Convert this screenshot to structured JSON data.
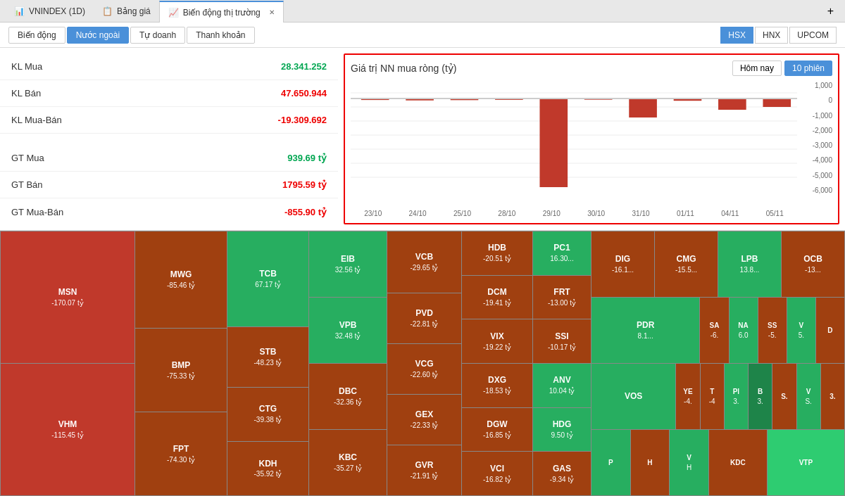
{
  "tabs": [
    {
      "id": "vnindex",
      "label": "VNINDEX (1D)",
      "icon": "📊",
      "active": false
    },
    {
      "id": "banggia",
      "label": "Bảng giá",
      "icon": "📋",
      "active": false
    },
    {
      "id": "biendong",
      "label": "Biến động thị trường",
      "icon": "📈",
      "active": true
    }
  ],
  "sub_nav": {
    "left_buttons": [
      {
        "id": "biendong",
        "label": "Biến động"
      },
      {
        "id": "nuocngoai",
        "label": "Nước ngoài",
        "active": true
      },
      {
        "id": "tudoanh",
        "label": "Tự doanh"
      },
      {
        "id": "thanhkhoan",
        "label": "Thanh khoản"
      }
    ],
    "right_buttons": [
      {
        "id": "hsx",
        "label": "HSX",
        "active": true
      },
      {
        "id": "hnx",
        "label": "HNX"
      },
      {
        "id": "upcom",
        "label": "UPCOM"
      }
    ]
  },
  "stats": [
    {
      "label": "KL Mua",
      "value": "28.341.252",
      "color": "green"
    },
    {
      "label": "KL Bán",
      "value": "47.650.944",
      "color": "red"
    },
    {
      "label": "KL Mua-Bán",
      "value": "-19.309.692",
      "color": "red"
    },
    {
      "spacer": true
    },
    {
      "label": "GT Mua",
      "value": "939.69 tỷ",
      "color": "green"
    },
    {
      "label": "GT Bán",
      "value": "1795.59 tỷ",
      "color": "red"
    },
    {
      "label": "GT Mua-Bán",
      "value": "-855.90 tỷ",
      "color": "red"
    }
  ],
  "chart": {
    "title": "Giá trị NN mua ròng (tỷ)",
    "period_buttons": [
      {
        "label": "Hôm nay"
      },
      {
        "label": "10 phiên",
        "active": true
      }
    ],
    "x_labels": [
      "23/10",
      "24/10",
      "25/10",
      "28/10",
      "29/10",
      "30/10",
      "31/10",
      "01/11",
      "04/11",
      "05/11"
    ],
    "y_labels": [
      "1,000",
      "0",
      "-1,000",
      "-2,000",
      "-3,000",
      "-4,000",
      "-5,000",
      "-6,000"
    ],
    "bars": [
      {
        "x": 0,
        "value": -50
      },
      {
        "x": 1,
        "value": -80
      },
      {
        "x": 2,
        "value": -60
      },
      {
        "x": 3,
        "value": -40
      },
      {
        "x": 4,
        "value": -5800
      },
      {
        "x": 5,
        "value": -30
      },
      {
        "x": 6,
        "value": -1200
      },
      {
        "x": 7,
        "value": -100
      },
      {
        "x": 8,
        "value": -700
      },
      {
        "x": 9,
        "value": -500
      }
    ]
  },
  "treemap": {
    "cells": [
      {
        "sym": "MSN",
        "val": "-170.07 tỷ",
        "bg": "dark-red",
        "size": "xl"
      },
      {
        "sym": "VHM",
        "val": "-115.45 tỷ",
        "bg": "dark-red",
        "size": "xl"
      },
      {
        "sym": "MWG",
        "val": "-85.46 tỷ",
        "bg": "orange",
        "size": "l"
      },
      {
        "sym": "BMP",
        "val": "-75.33 tỷ",
        "bg": "orange",
        "size": "l"
      },
      {
        "sym": "FPT",
        "val": "-74.30 tỷ",
        "bg": "orange",
        "size": "l"
      },
      {
        "sym": "TCB",
        "val": "67.17 tỷ",
        "bg": "green",
        "size": "l"
      },
      {
        "sym": "STB",
        "val": "-48.23 tỷ",
        "bg": "orange",
        "size": "m"
      },
      {
        "sym": "CTG",
        "val": "-39.38 tỷ",
        "bg": "orange",
        "size": "m"
      },
      {
        "sym": "KDH",
        "val": "-35.92 tỷ",
        "bg": "orange",
        "size": "m"
      },
      {
        "sym": "EIB",
        "val": "32.56 tỷ",
        "bg": "green",
        "size": "m"
      },
      {
        "sym": "VPB",
        "val": "32.48 tỷ",
        "bg": "green",
        "size": "m"
      },
      {
        "sym": "DBC",
        "val": "-32.36 tỷ",
        "bg": "orange",
        "size": "m"
      },
      {
        "sym": "KBC",
        "val": "-35.27 tỷ",
        "bg": "orange",
        "size": "m"
      },
      {
        "sym": "VCB",
        "val": "-29.65 tỷ",
        "bg": "orange",
        "size": "m"
      },
      {
        "sym": "PVD",
        "val": "-22.81 tỷ",
        "bg": "orange",
        "size": "sm"
      },
      {
        "sym": "VCG",
        "val": "-22.60 tỷ",
        "bg": "orange",
        "size": "sm"
      },
      {
        "sym": "GEX",
        "val": "-22.33 tỷ",
        "bg": "orange",
        "size": "sm"
      },
      {
        "sym": "GVR",
        "val": "-21.91 tỷ",
        "bg": "orange",
        "size": "sm"
      },
      {
        "sym": "HDB",
        "val": "-20.51 tỷ",
        "bg": "orange",
        "size": "sm"
      },
      {
        "sym": "DCM",
        "val": "-19.41 tỷ",
        "bg": "orange",
        "size": "sm"
      },
      {
        "sym": "VIX",
        "val": "-19.22 tỷ",
        "bg": "orange",
        "size": "sm"
      },
      {
        "sym": "DXG",
        "val": "-18.53 tỷ",
        "bg": "orange",
        "size": "sm"
      },
      {
        "sym": "DGW",
        "val": "-16.85 tỷ",
        "bg": "orange",
        "size": "sm"
      },
      {
        "sym": "VCI",
        "val": "-16.82 tỷ",
        "bg": "orange",
        "size": "sm"
      },
      {
        "sym": "PC1",
        "val": "16.30...",
        "bg": "green",
        "size": "sm"
      },
      {
        "sym": "FRT",
        "val": "-13.00 tỷ",
        "bg": "orange",
        "size": "sm"
      },
      {
        "sym": "SSI",
        "val": "-10.17 tỷ",
        "bg": "orange",
        "size": "sm"
      },
      {
        "sym": "ANV",
        "val": "10.04 tỷ",
        "bg": "green",
        "size": "sm"
      },
      {
        "sym": "HDG",
        "val": "9.50 tỷ",
        "bg": "green",
        "size": "sm"
      },
      {
        "sym": "GAS",
        "val": "-9.34 tỷ",
        "bg": "orange",
        "size": "sm"
      },
      {
        "sym": "DIG",
        "val": "-16.1...",
        "bg": "orange",
        "size": "sm"
      },
      {
        "sym": "CMG",
        "val": "-15.5...",
        "bg": "orange",
        "size": "sm"
      },
      {
        "sym": "LPB",
        "val": "13.8...",
        "bg": "green",
        "size": "sm"
      },
      {
        "sym": "OCB",
        "val": "-13...",
        "bg": "orange",
        "size": "sm"
      },
      {
        "sym": "PDR",
        "val": "8.1...",
        "bg": "green",
        "size": "xs"
      },
      {
        "sym": "SA",
        "val": "-6.",
        "bg": "orange",
        "size": "xs"
      },
      {
        "sym": "NA",
        "val": "6.0",
        "bg": "green",
        "size": "xs"
      },
      {
        "sym": "SS",
        "val": "-5.",
        "bg": "orange",
        "size": "xs"
      },
      {
        "sym": "V",
        "val": "5.",
        "bg": "green",
        "size": "xs"
      },
      {
        "sym": "D",
        "val": "",
        "bg": "orange",
        "size": "xs"
      },
      {
        "sym": "YE",
        "val": "-4.",
        "bg": "orange",
        "size": "xs"
      },
      {
        "sym": "T",
        "val": "-4",
        "bg": "orange",
        "size": "xs"
      },
      {
        "sym": "Pl",
        "val": "3.",
        "bg": "green",
        "size": "xs"
      },
      {
        "sym": "B",
        "val": "3.",
        "bg": "dark-green",
        "size": "xs"
      },
      {
        "sym": "S.",
        "val": "",
        "bg": "orange",
        "size": "xs"
      },
      {
        "sym": "V",
        "val": "S.",
        "bg": "green",
        "size": "xs"
      },
      {
        "sym": "3.",
        "val": "",
        "bg": "orange",
        "size": "xs"
      },
      {
        "sym": "VOS",
        "val": "",
        "bg": "orange",
        "size": "xs"
      },
      {
        "sym": "P",
        "val": "",
        "bg": "green",
        "size": "xs"
      },
      {
        "sym": "H",
        "val": "",
        "bg": "orange",
        "size": "xs"
      },
      {
        "sym": "V",
        "val": "H",
        "bg": "green",
        "size": "xs"
      },
      {
        "sym": "KDC",
        "val": "",
        "bg": "orange",
        "size": "xs"
      },
      {
        "sym": "VTP",
        "val": "",
        "bg": "light-green",
        "size": "xs"
      }
    ]
  }
}
